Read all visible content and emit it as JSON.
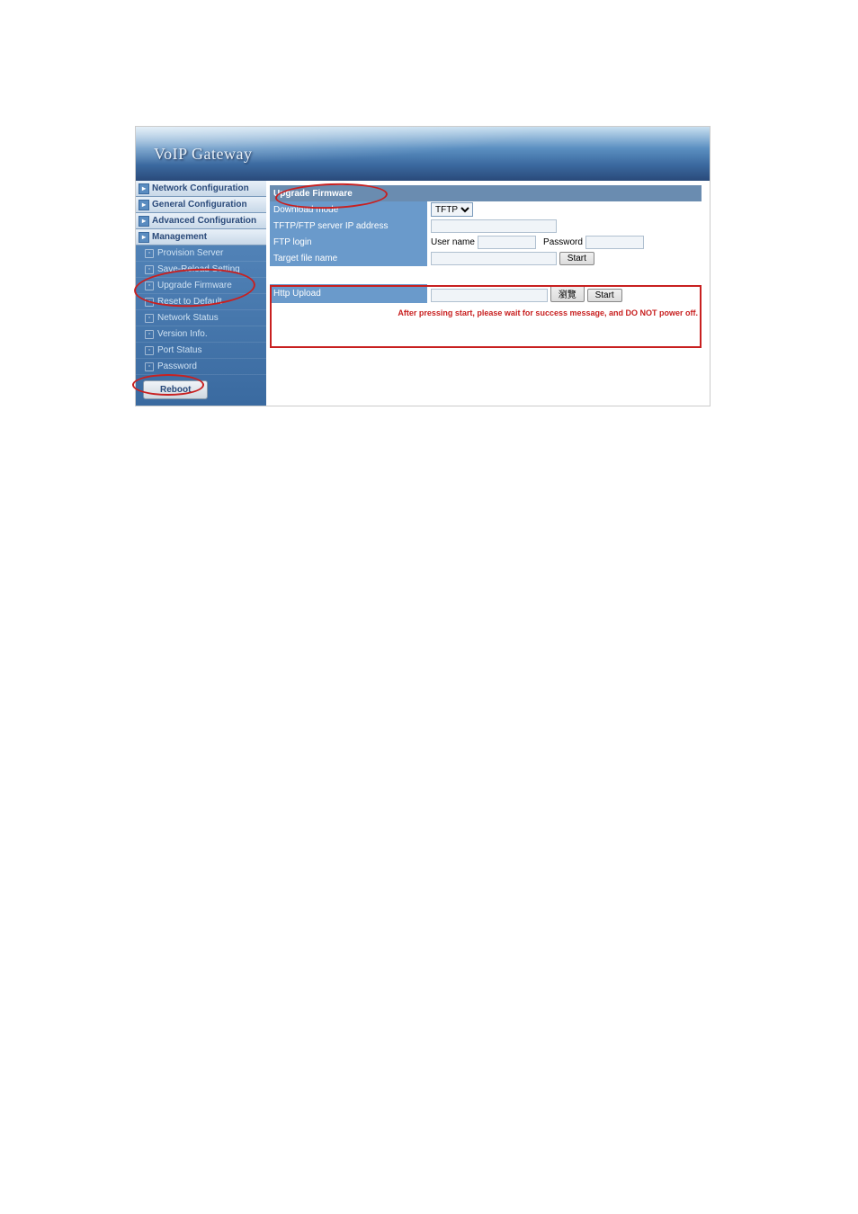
{
  "header": {
    "title": "VoIP Gateway"
  },
  "sidebar": {
    "items": [
      {
        "label": "Network Configuration"
      },
      {
        "label": "General Configuration"
      },
      {
        "label": "Advanced Configuration"
      },
      {
        "label": "Management"
      }
    ],
    "subitems": [
      {
        "label": "Provision Server"
      },
      {
        "label": "Save-Reload Setting"
      },
      {
        "label": "Upgrade Firmware"
      },
      {
        "label": "Reset to Default"
      },
      {
        "label": "Network Status"
      },
      {
        "label": "Version Info."
      },
      {
        "label": "Port Status"
      },
      {
        "label": "Password"
      }
    ],
    "reboot": "Reboot"
  },
  "form": {
    "section1": "Upgrade Firmware",
    "download_mode_label": "Download mode",
    "download_mode_value": "TFTP",
    "server_ip_label": "TFTP/FTP server IP address",
    "ftp_login_label": "FTP login",
    "username_label": "User name",
    "password_label": "Password",
    "target_file_label": "Target file name",
    "start1": "Start",
    "http_upload_label": "Http Upload",
    "browse": "瀏覽",
    "start2": "Start",
    "warn": "After pressing start, please wait for success message, and DO NOT power off."
  }
}
